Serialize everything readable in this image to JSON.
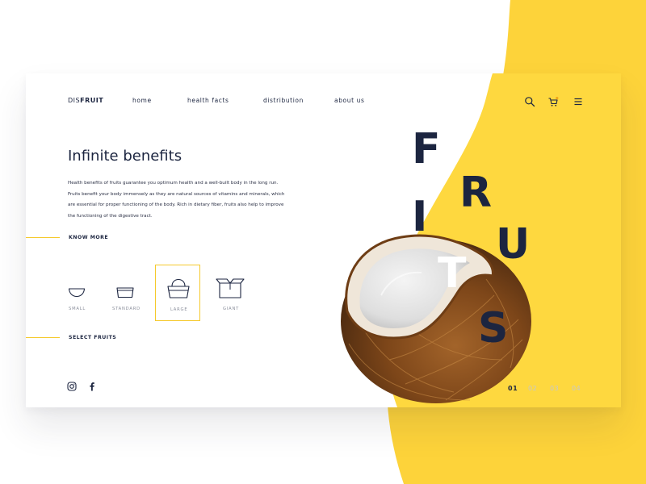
{
  "brand": {
    "prefix": "DIS",
    "suffix": "FRUIT"
  },
  "nav": {
    "items": [
      {
        "label": "home"
      },
      {
        "label": "health facts"
      },
      {
        "label": "distribution"
      },
      {
        "label": "about us"
      }
    ]
  },
  "header_icons": [
    "search-icon",
    "cart-icon",
    "menu-icon"
  ],
  "hero": {
    "title": "Infinite benefits",
    "body": "Health benefits of fruits guarantee you optimum health and a well-built body in the long run. Fruits benefit your body immensely as they are natural sources of vitamins and minerals, which are essential for proper functioning of the body. Rich in dietary fiber, fruits also help to improve the functioning of the digestive tract.",
    "know_more": "KNOW MORE",
    "select_fruits": "SELECT FRUITS"
  },
  "sizes": [
    {
      "label": "SMALL",
      "icon": "small-bowl-icon"
    },
    {
      "label": "STANDARD",
      "icon": "standard-bowl-icon"
    },
    {
      "label": "LARGE",
      "icon": "basket-icon",
      "selected": true
    },
    {
      "label": "GIANT",
      "icon": "box-icon"
    }
  ],
  "social": [
    "instagram-icon",
    "facebook-icon"
  ],
  "pagination": [
    "01",
    "02",
    "03",
    "04"
  ],
  "pagination_active": "01",
  "big_text": {
    "letters": [
      "F",
      "R",
      "U",
      "I",
      "T",
      "S"
    ]
  },
  "colors": {
    "accent": "#FDD33A",
    "dark": "#1C2540",
    "muted": "#C5C7CE"
  }
}
